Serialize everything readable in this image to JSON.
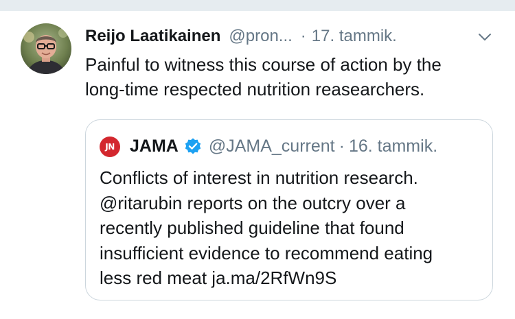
{
  "tweet": {
    "author_name": "Reijo Laatikainen",
    "author_handle": "@pron...",
    "dot": "·",
    "date": "17. tammik.",
    "text_lines": [
      "Painful to witness this course of action by the",
      "long-time respected nutrition reasearchers."
    ]
  },
  "quote": {
    "avatar_text": "JN",
    "name": "JAMA",
    "handle": "@JAMA_current",
    "dot": "·",
    "date": "16. tammik.",
    "text_lines": [
      "Conflicts of interest in nutrition research.",
      "@ritarubin reports on the outcry over a",
      "recently published guideline that found",
      "insufficient evidence to recommend eating",
      "less red meat ja.ma/2RfWn9S"
    ]
  },
  "colors": {
    "text": "#14171a",
    "secondary": "#657786",
    "border": "#ccd6dd",
    "verified": "#1da1f2",
    "jama_red": "#d3272e",
    "top_strip": "#e6ecf0"
  },
  "icons": {
    "chevron": "chevron-down-icon",
    "verified": "verified-badge-icon",
    "avatar": "profile-photo"
  }
}
